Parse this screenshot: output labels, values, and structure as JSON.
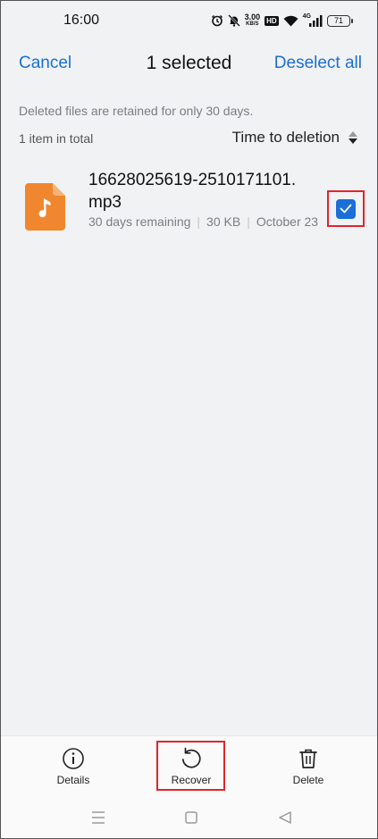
{
  "status_bar": {
    "time": "16:00",
    "net_speed_value": "3.00",
    "net_speed_unit": "KB/S",
    "hd_badge": "HD",
    "signal_label": "4G",
    "battery": "71",
    "icons": [
      "alarm-icon",
      "mute-bell-icon",
      "wifi-icon",
      "signal-icon",
      "battery-icon"
    ]
  },
  "header": {
    "cancel_label": "Cancel",
    "title": "1 selected",
    "deselect_label": "Deselect all",
    "accent_color": "#1a6fd8"
  },
  "notice": "Deleted files are retained for only 30 days.",
  "count": "1 item in total",
  "sort": {
    "label": "Time to deletion"
  },
  "files": [
    {
      "name": "16628025619-2510171101.mp3",
      "remaining": "30 days remaining",
      "size": "30 KB",
      "date": "October 23",
      "icon": "music-file-icon",
      "icon_color": "#f0872e",
      "checked": true
    }
  ],
  "actions": {
    "details_label": "Details",
    "recover_label": "Recover",
    "delete_label": "Delete"
  },
  "nav": {
    "icons": [
      "menu-icon",
      "home-icon",
      "back-icon"
    ]
  },
  "highlight_color": "#e0252b"
}
